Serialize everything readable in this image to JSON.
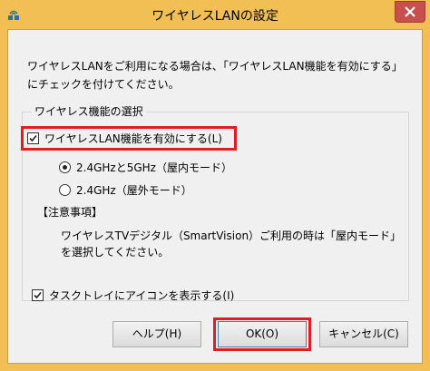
{
  "window": {
    "title": "ワイヤレスLANの設定",
    "frame_color": "#f2bf54",
    "close_color": "#c7504f"
  },
  "intro": {
    "line1": "ワイヤレスLANをご利用になる場合は、「ワイヤレスLAN機能を有効にする」",
    "line2": "にチェックを付けてください。"
  },
  "wireless_group": {
    "label": "ワイヤレス機能の選択",
    "enable_checkbox": {
      "label": "ワイヤレスLAN機能を有効にする(L)",
      "checked": true
    },
    "radios": [
      {
        "label": "2.4GHzと5GHz（屋内モード）",
        "selected": true
      },
      {
        "label": "2.4GHz（屋外モード）",
        "selected": false
      }
    ],
    "notes_heading": "【注意事項】",
    "notes_line1": "ワイヤレスTVデジタル（SmartVision）ご利用の時は「屋内モード」",
    "notes_line2": "を選択してください。"
  },
  "tray_checkbox": {
    "label": "タスクトレイにアイコンを表示する(I)",
    "checked": true
  },
  "buttons": {
    "help": "ヘルプ(H)",
    "ok": "OK(O)",
    "cancel": "キャンセル(C)"
  },
  "highlight_color": "#e01e1e"
}
